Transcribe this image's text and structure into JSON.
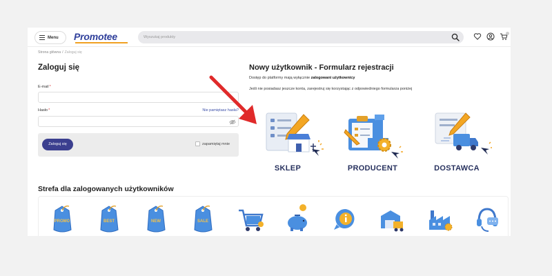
{
  "header": {
    "menu_label": "Menu",
    "logo_text": "Promotee",
    "search_placeholder": "Wyszukaj produkty",
    "icons": [
      "search-icon",
      "heart-icon",
      "user-icon",
      "cart-icon"
    ]
  },
  "breadcrumb": {
    "home": "Strona główna",
    "separator": "/",
    "current": "Zaloguj się"
  },
  "login": {
    "title": "Zaloguj się",
    "email_label": "E-mail",
    "password_label": "Hasło",
    "required_mark": "*",
    "forgot_link": "Nie pamiętasz hasła?",
    "email_value": "",
    "password_value": "",
    "submit_label": "Zaloguj się",
    "remember_label": "zapamiętaj mnie",
    "remember_checked": false
  },
  "register": {
    "title": "Nowy użytkownik - Formularz rejestracji",
    "info_prefix": "Dostęp do platformy mają wyłącznie ",
    "info_bold": "zalogowani użytkownicy",
    "info_line2": "Jeśli nie posiadasz jeszcze konta, zarejestruj się korzystając z odpowiedniego formularza poniżej",
    "options": [
      {
        "label": "SKLEP",
        "icon": "shop-form-icon"
      },
      {
        "label": "PRODUCENT",
        "icon": "producer-form-icon"
      },
      {
        "label": "DOSTAWCA",
        "icon": "supplier-form-icon"
      }
    ]
  },
  "zone": {
    "title": "Strefa dla zalogowanych użytkowników",
    "tag_texts": [
      "PROMO",
      "BEST",
      "NEW",
      "SALE"
    ],
    "icons": [
      "promo-tag-icon",
      "best-tag-icon",
      "new-tag-icon",
      "sale-tag-icon",
      "cart-icon",
      "piggy-bank-icon",
      "info-icon",
      "warehouse-icon",
      "factory-icon",
      "support-headset-icon"
    ]
  },
  "colors": {
    "brand": "#2f3f9b",
    "accent": "#f0a020",
    "button": "#3b3f8f",
    "arrow": "#e02a2a",
    "icon_blue": "#4a8fe0"
  }
}
